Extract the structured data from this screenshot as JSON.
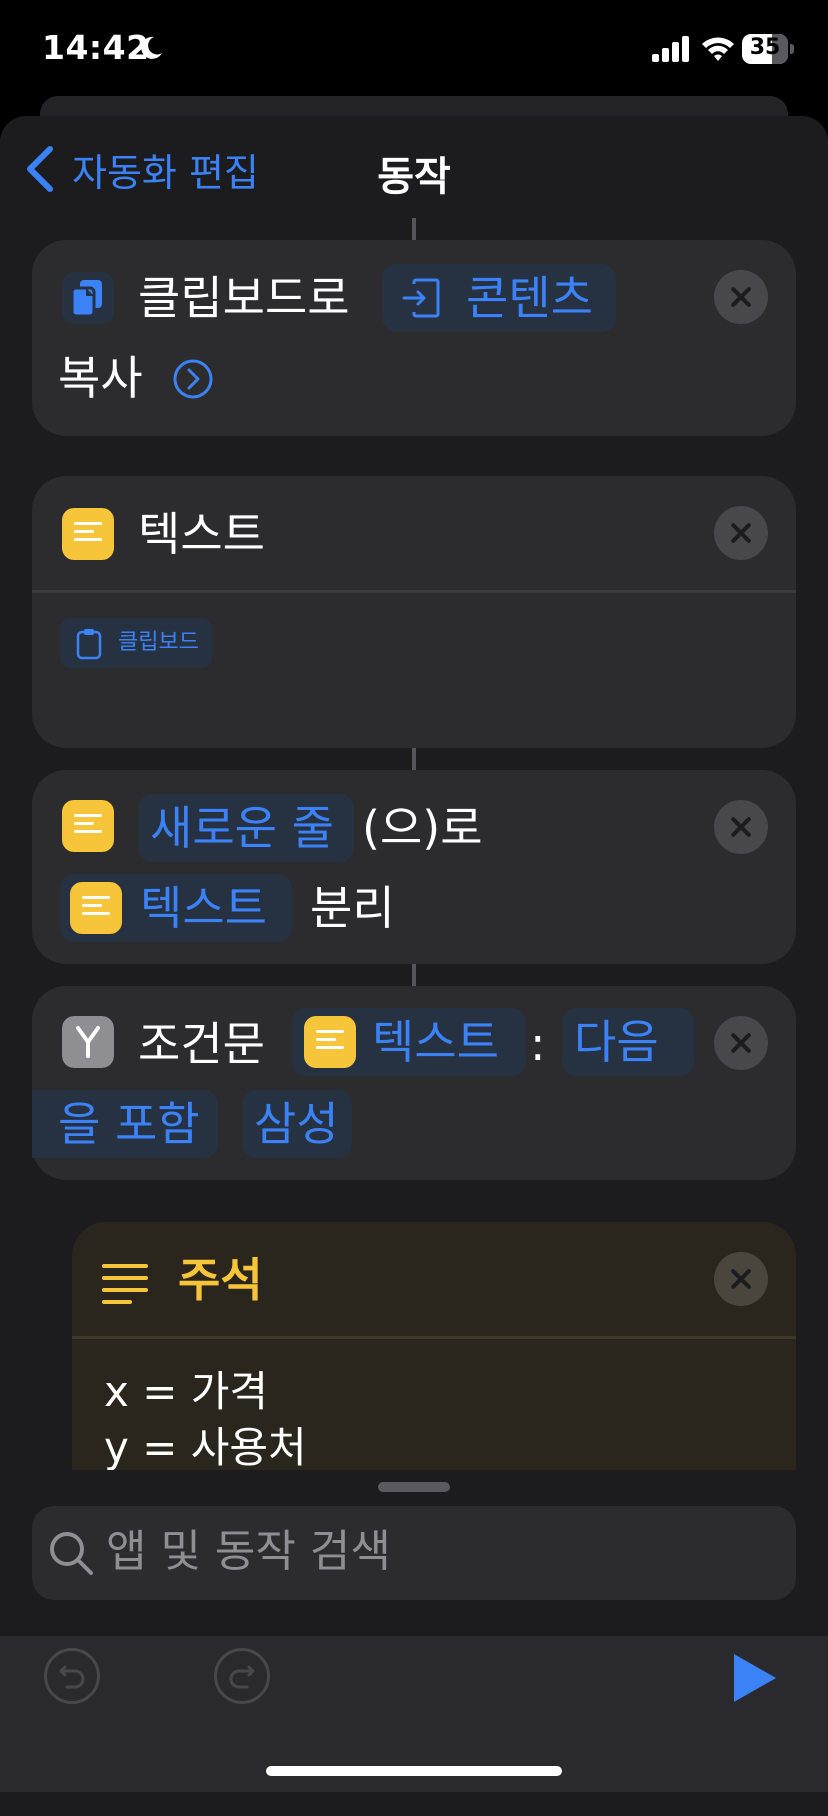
{
  "status_bar": {
    "time": "14:42",
    "battery": "35"
  },
  "nav": {
    "back_label": "자동화 편집",
    "title": "동작"
  },
  "actions": {
    "copy": {
      "label_1": "클립보드로",
      "token": "콘텐츠",
      "label_2": "복사"
    },
    "text": {
      "title": "텍스트",
      "token": "클립보드"
    },
    "split": {
      "token_1": "새로운 줄",
      "label_1": "(으)로",
      "token_2": "텍스트",
      "label_2": "분리"
    },
    "if": {
      "title": "조건문",
      "token_input": "텍스트",
      "colon": ":",
      "token_cond_1": "다음",
      "token_cond_2": "을 포함",
      "token_value": "삼성"
    },
    "comment": {
      "title": "주석",
      "line_1": "x = 가격",
      "line_2": "y = 사용처"
    }
  },
  "search": {
    "placeholder": "앱 및 동작 검색"
  },
  "icons": {
    "accent": "#3b82f6",
    "text_app": "#f7c539",
    "scripting_app": "#8e8e93",
    "comment_color": "#f7c539"
  }
}
